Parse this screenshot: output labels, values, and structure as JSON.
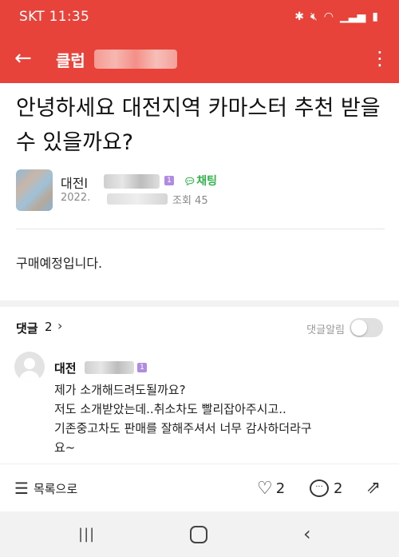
{
  "status_bar": {
    "carrier_time": "SKT 11:35",
    "icons": [
      "bluetooth-icon",
      "mute-icon",
      "wifi-icon",
      "signal-icon",
      "battery-icon"
    ]
  },
  "app_bar": {
    "title": "클럽",
    "color": "#e8433a"
  },
  "post": {
    "title": "안녕하세요 대전지역 카마스터 추천 받을 수 있을까요?",
    "author_name": "대전l",
    "level_badge": "1",
    "chat_label": "채팅",
    "date_prefix": "2022.",
    "views": "조회 45",
    "body": "구매예정입니다."
  },
  "comments": {
    "label": "댓글",
    "count": "2",
    "alert_label": "댓글알림",
    "alert_on": false,
    "items": [
      {
        "author": "대전",
        "level_badge": "1",
        "lines": [
          "제가 소개해드려도될까요?",
          "저도 소개받았는데..취소차도 빨리잡아주시고..",
          "기존중고차도 판매를 잘해주셔서 너무 감사하더라구",
          "요~"
        ]
      }
    ]
  },
  "action_bar": {
    "list_label": "목록으로",
    "likes": "2",
    "comments": "2"
  },
  "colors": {
    "accent": "#e8433a",
    "chat_green": "#2fb34a",
    "level_purple": "#b08be0"
  }
}
